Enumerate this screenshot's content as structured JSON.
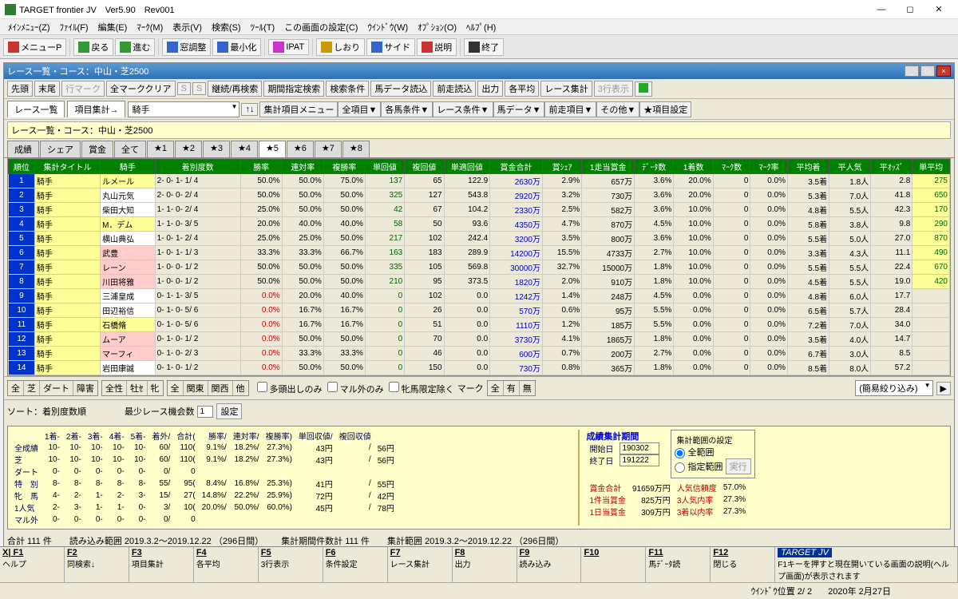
{
  "app": {
    "title": "TARGET frontier JV　Ver5.90　Rev001"
  },
  "menubar": [
    "ﾒｲﾝﾒﾆｭｰ(Z)",
    "ﾌｧｲﾙ(F)",
    "編集(E)",
    "ﾏｰｸ(M)",
    "表示(V)",
    "検索(S)",
    "ﾂｰﾙ(T)",
    "この画面の設定(C)",
    "ｳｲﾝﾄﾞｳ(W)",
    "ｵﾌﾟｼｮﾝ(O)",
    "ﾍﾙﾌﾟ(H)"
  ],
  "toolbar": {
    "items": [
      "メニューP",
      "戻る",
      "進む",
      "窓調整",
      "最小化",
      "IPAT",
      "しおり",
      "サイド",
      "説明",
      "終了"
    ]
  },
  "child": {
    "title": "レース一覧・コース：中山・芝2500",
    "row1": [
      "先頭",
      "末尾",
      "行マーク",
      "全マーククリア",
      "S",
      "S",
      "継続/再検索",
      "期間指定検索",
      "検索条件",
      "馬データ読込",
      "前走読込",
      "出力",
      "各平均",
      "レース集計",
      "3行表示"
    ],
    "tabs1": [
      "レース一覧",
      "項目集計→"
    ],
    "dropdown": "騎手",
    "row2btns": [
      "集計項目メニュー",
      "全項目▼",
      "各馬条件▼",
      "レース条件▼",
      "馬データ▼",
      "前走項目▼",
      "その他▼",
      "★項目設定"
    ],
    "info": "レース一覧・コース：中山・芝2500",
    "tabs2": [
      "成績",
      "シェア",
      "賞金",
      "全て",
      "★1",
      "★2",
      "★3",
      "★4",
      "★5",
      "★6",
      "★7",
      "★8"
    ],
    "active_tab2": 8
  },
  "grid": {
    "headers": [
      "順位",
      "集計タイトル",
      "騎手",
      "着別度数",
      "勝率",
      "連対率",
      "複勝率",
      "単回値",
      "複回値",
      "単適回値",
      "賞金合計",
      "賞ｼｪｱ",
      "1走当賞金",
      "ﾃﾞｰﾀ数",
      "1着数",
      "ﾏｰｸ数",
      "ﾏｰｸ率",
      "平均着",
      "平人気",
      "平ｵｯｽﾞ",
      "単平均"
    ],
    "rows": [
      {
        "n": 1,
        "t": "騎手",
        "j": "ルメール",
        "jc": "#ffff99",
        "d": "2- 0- 1- 1/ 4",
        "w": "50.0%",
        "r": "50.0%",
        "f": "75.0%",
        "ut": 137,
        "uf": 65,
        "ua": "122.9",
        "pz": "2630万",
        "ps": "2.9%",
        "pw": "657万",
        "dn": "3.6%",
        "w1": "20.0%",
        "mk": 0,
        "mr": "0.0%",
        "ac": "3.5着",
        "ap": "1.8人",
        "ao": "2.8",
        "up": 275,
        "upc": "#006600"
      },
      {
        "n": 2,
        "t": "騎手",
        "j": "丸山元気",
        "d": "2- 0- 0- 2/ 4",
        "w": "50.0%",
        "r": "50.0%",
        "f": "50.0%",
        "ut": 325,
        "uf": 127,
        "ua": "543.8",
        "pz": "2920万",
        "ps": "3.2%",
        "pw": "730万",
        "dn": "3.6%",
        "w1": "20.0%",
        "mk": 0,
        "mr": "0.0%",
        "ac": "5.3着",
        "ap": "7.0人",
        "ao": "41.8",
        "up": 650,
        "upc": "#006600"
      },
      {
        "n": 3,
        "t": "騎手",
        "j": "柴田大知",
        "d": "1- 1- 0- 2/ 4",
        "w": "25.0%",
        "r": "50.0%",
        "f": "50.0%",
        "ut": 42,
        "uf": 67,
        "ua": "104.2",
        "pz": "2330万",
        "ps": "2.5%",
        "pw": "582万",
        "dn": "3.6%",
        "w1": "10.0%",
        "mk": 0,
        "mr": "0.0%",
        "ac": "4.8着",
        "ap": "5.5人",
        "ao": "42.3",
        "up": 170,
        "upc": "#006600"
      },
      {
        "n": 4,
        "t": "騎手",
        "j": "M．デム",
        "jc": "#ffff99",
        "d": "1- 1- 0- 3/ 5",
        "w": "20.0%",
        "r": "40.0%",
        "f": "40.0%",
        "ut": 58,
        "uf": 50,
        "ua": "93.6",
        "pz": "4350万",
        "ps": "4.7%",
        "pw": "870万",
        "dn": "4.5%",
        "w1": "10.0%",
        "mk": 0,
        "mr": "0.0%",
        "ac": "5.8着",
        "ap": "3.8人",
        "ao": "9.8",
        "up": 290,
        "upc": "#006600"
      },
      {
        "n": 5,
        "t": "騎手",
        "j": "横山典弘",
        "d": "1- 0- 1- 2/ 4",
        "w": "25.0%",
        "r": "25.0%",
        "f": "50.0%",
        "ut": 217,
        "uf": 102,
        "ua": "242.4",
        "pz": "3200万",
        "ps": "3.5%",
        "pw": "800万",
        "dn": "3.6%",
        "w1": "10.0%",
        "mk": 0,
        "mr": "0.0%",
        "ac": "5.5着",
        "ap": "5.0人",
        "ao": "27.0",
        "up": 870,
        "upc": "#006600"
      },
      {
        "n": 6,
        "t": "騎手",
        "j": "武豊",
        "jc": "#ffcccc",
        "d": "1- 0- 1- 1/ 3",
        "w": "33.3%",
        "r": "33.3%",
        "f": "66.7%",
        "ut": 163,
        "uf": 183,
        "ua": "289.9",
        "pz": "14200万",
        "ps": "15.5%",
        "pw": "4733万",
        "dn": "2.7%",
        "w1": "10.0%",
        "mk": 0,
        "mr": "0.0%",
        "ac": "3.3着",
        "ap": "4.3人",
        "ao": "11.1",
        "up": 490,
        "upc": "#006600"
      },
      {
        "n": 7,
        "t": "騎手",
        "j": "レーン",
        "jc": "#ffcccc",
        "d": "1- 0- 0- 1/ 2",
        "w": "50.0%",
        "r": "50.0%",
        "f": "50.0%",
        "ut": 335,
        "uf": 105,
        "ua": "569.8",
        "pz": "30000万",
        "ps": "32.7%",
        "pw": "15000万",
        "dn": "1.8%",
        "w1": "10.0%",
        "mk": 0,
        "mr": "0.0%",
        "ac": "5.5着",
        "ap": "5.5人",
        "ao": "22.4",
        "up": 670,
        "upc": "#006600"
      },
      {
        "n": 8,
        "t": "騎手",
        "j": "川田将雅",
        "jc": "#ffcccc",
        "d": "1- 0- 0- 1/ 2",
        "w": "50.0%",
        "r": "50.0%",
        "f": "50.0%",
        "ut": 210,
        "uf": 95,
        "ua": "373.5",
        "pz": "1820万",
        "ps": "2.0%",
        "pw": "910万",
        "dn": "1.8%",
        "w1": "10.0%",
        "mk": 0,
        "mr": "0.0%",
        "ac": "4.5着",
        "ap": "5.5人",
        "ao": "19.0",
        "up": 420,
        "upc": "#006600"
      },
      {
        "n": 9,
        "t": "騎手",
        "j": "三浦皇成",
        "d": "0- 1- 1- 3/ 5",
        "w": "0.0%",
        "r": "20.0%",
        "f": "40.0%",
        "ut": 0,
        "uf": 102,
        "ua": "0.0",
        "pz": "1242万",
        "ps": "1.4%",
        "pw": "248万",
        "dn": "4.5%",
        "w1": "0.0%",
        "mk": 0,
        "mr": "0.0%",
        "ac": "4.8着",
        "ap": "6.0人",
        "ao": "17.7",
        "up": ""
      },
      {
        "n": 10,
        "t": "騎手",
        "j": "田辺裕信",
        "d": "0- 1- 0- 5/ 6",
        "w": "0.0%",
        "r": "16.7%",
        "f": "16.7%",
        "ut": 0,
        "uf": 26,
        "ua": "0.0",
        "pz": "570万",
        "ps": "0.6%",
        "pw": "95万",
        "dn": "5.5%",
        "w1": "0.0%",
        "mk": 0,
        "mr": "0.0%",
        "ac": "6.5着",
        "ap": "5.7人",
        "ao": "28.4",
        "up": ""
      },
      {
        "n": 11,
        "t": "騎手",
        "j": "石橋脩",
        "jc": "#ffff99",
        "d": "0- 1- 0- 5/ 6",
        "w": "0.0%",
        "r": "16.7%",
        "f": "16.7%",
        "ut": 0,
        "uf": 51,
        "ua": "0.0",
        "pz": "1110万",
        "ps": "1.2%",
        "pw": "185万",
        "dn": "5.5%",
        "w1": "0.0%",
        "mk": 0,
        "mr": "0.0%",
        "ac": "7.2着",
        "ap": "7.0人",
        "ao": "34.0",
        "up": ""
      },
      {
        "n": 12,
        "t": "騎手",
        "j": "ムーア",
        "jc": "#ffcccc",
        "d": "0- 1- 0- 1/ 2",
        "w": "0.0%",
        "r": "50.0%",
        "f": "50.0%",
        "ut": 0,
        "uf": 70,
        "ua": "0.0",
        "pz": "3730万",
        "ps": "4.1%",
        "pw": "1865万",
        "dn": "1.8%",
        "w1": "0.0%",
        "mk": 0,
        "mr": "0.0%",
        "ac": "3.5着",
        "ap": "4.0人",
        "ao": "14.7",
        "up": ""
      },
      {
        "n": 13,
        "t": "騎手",
        "j": "マーフィ",
        "jc": "#ffcccc",
        "d": "0- 1- 0- 2/ 3",
        "w": "0.0%",
        "r": "33.3%",
        "f": "33.3%",
        "ut": 0,
        "uf": 46,
        "ua": "0.0",
        "pz": "600万",
        "ps": "0.7%",
        "pw": "200万",
        "dn": "2.7%",
        "w1": "0.0%",
        "mk": 0,
        "mr": "0.0%",
        "ac": "6.7着",
        "ap": "3.0人",
        "ao": "8.5",
        "up": ""
      },
      {
        "n": 14,
        "t": "騎手",
        "j": "岩田康誠",
        "d": "0- 1- 0- 1/ 2",
        "w": "0.0%",
        "r": "50.0%",
        "f": "50.0%",
        "ut": 0,
        "uf": 150,
        "ua": "0.0",
        "pz": "730万",
        "ps": "0.8%",
        "pw": "365万",
        "dn": "1.8%",
        "w1": "0.0%",
        "mk": 0,
        "mr": "0.0%",
        "ac": "8.5着",
        "ap": "8.0人",
        "ao": "57.2",
        "up": ""
      }
    ]
  },
  "filters": {
    "g1": [
      "全",
      "芝",
      "ダート",
      "障害"
    ],
    "g2": [
      "全性",
      "牡ｾ",
      "牝"
    ],
    "g3": [
      "全",
      "関東",
      "関西",
      "他"
    ],
    "chk": [
      "多頭出しのみ",
      "マル外のみ",
      "牝馬限定除く"
    ],
    "mark_lbl": "マーク",
    "g4": [
      "全",
      "有",
      "無"
    ],
    "quick": "(簡易絞り込み)",
    "sort_lbl": "ソート：着別度数順",
    "min_lbl": "最少レース機会数",
    "min_val": "1",
    "set_btn": "設定"
  },
  "summary": {
    "head": [
      "",
      "1着-",
      "2着-",
      "3着-",
      "4着-",
      "5着-",
      "着外/",
      "合計(",
      "勝率/",
      "連対率/",
      "複勝率)",
      "単回収値/",
      "複回収値"
    ],
    "rows": [
      [
        "全成績",
        "10-",
        "10-",
        "10-",
        "10-",
        "10-",
        "60/",
        "110(",
        "9.1%/",
        "18.2%/",
        "27.3%)",
        "43円",
        "/",
        "56円"
      ],
      [
        "芝",
        "10-",
        "10-",
        "10-",
        "10-",
        "10-",
        "60/",
        "110(",
        "9.1%/",
        "18.2%/",
        "27.3%)",
        "43円",
        "/",
        "56円"
      ],
      [
        "ダート",
        "0-",
        "0-",
        "0-",
        "0-",
        "0-",
        "0/",
        "0",
        "",
        "",
        "",
        "",
        ""
      ],
      [
        "特　別",
        "8-",
        "8-",
        "8-",
        "8-",
        "8-",
        "55/",
        "95(",
        "8.4%/",
        "16.8%/",
        "25.3%)",
        "41円",
        "/",
        "55円"
      ],
      [
        "牝　馬",
        "4-",
        "2-",
        "1-",
        "2-",
        "3-",
        "15/",
        "27(",
        "14.8%/",
        "22.2%/",
        "25.9%)",
        "72円",
        "/",
        "42円"
      ],
      [
        "1人気",
        "2-",
        "3-",
        "1-",
        "1-",
        "0-",
        "3/",
        "10(",
        "20.0%/",
        "50.0%/",
        "60.0%)",
        "45円",
        "/",
        "78円"
      ],
      [
        "マル外",
        "0-",
        "0-",
        "0-",
        "0-",
        "0-",
        "0/",
        "0",
        "",
        "",
        "",
        "",
        ""
      ]
    ],
    "totals": [
      "合計 111 件",
      "読み込み範囲 2019.3.2～2019.12.22 （296日間）",
      "集計期間件数計 111 件",
      "集計範囲 2019.3.2～2019.12.22 （296日間）"
    ],
    "period": {
      "title": "成績集計期間",
      "start_lbl": "開始日",
      "start": "190302",
      "end_lbl": "終了日",
      "end": "191222",
      "scope_title": "集計範囲の設定",
      "r1": "全範囲",
      "r2": "指定範囲",
      "exec": "実行"
    },
    "stats": [
      [
        "賞金合計",
        "91659万円",
        "人気信頼度",
        "57.0%"
      ],
      [
        "1件当賞金",
        "825万円",
        "3人気内率",
        "27.3%"
      ],
      [
        "1日当賞金",
        "309万円",
        "3着以内率",
        "27.3%"
      ]
    ]
  },
  "fkeys": {
    "row1": [
      "X| F1",
      "F2",
      "F3",
      "F4",
      "F5",
      "F6",
      "F7",
      "F8",
      "F9",
      "F10",
      "F11",
      "F12",
      "TARGET  JV"
    ],
    "row2": [
      "ヘルプ",
      "同検索↓",
      "項目集計",
      "各平均",
      "3行表示",
      "条件設定",
      "レース集計",
      "出力",
      "読み込み",
      "",
      "馬ﾃﾞｰﾀ読",
      "閉じる",
      "F1キーを押すと現在開いている画面の説明(ヘルプ画面)が表示されます"
    ]
  },
  "status": {
    "pos": "ｳｲﾝﾄﾞｳ位置 2/ 2",
    "date": "2020年 2月27日"
  }
}
